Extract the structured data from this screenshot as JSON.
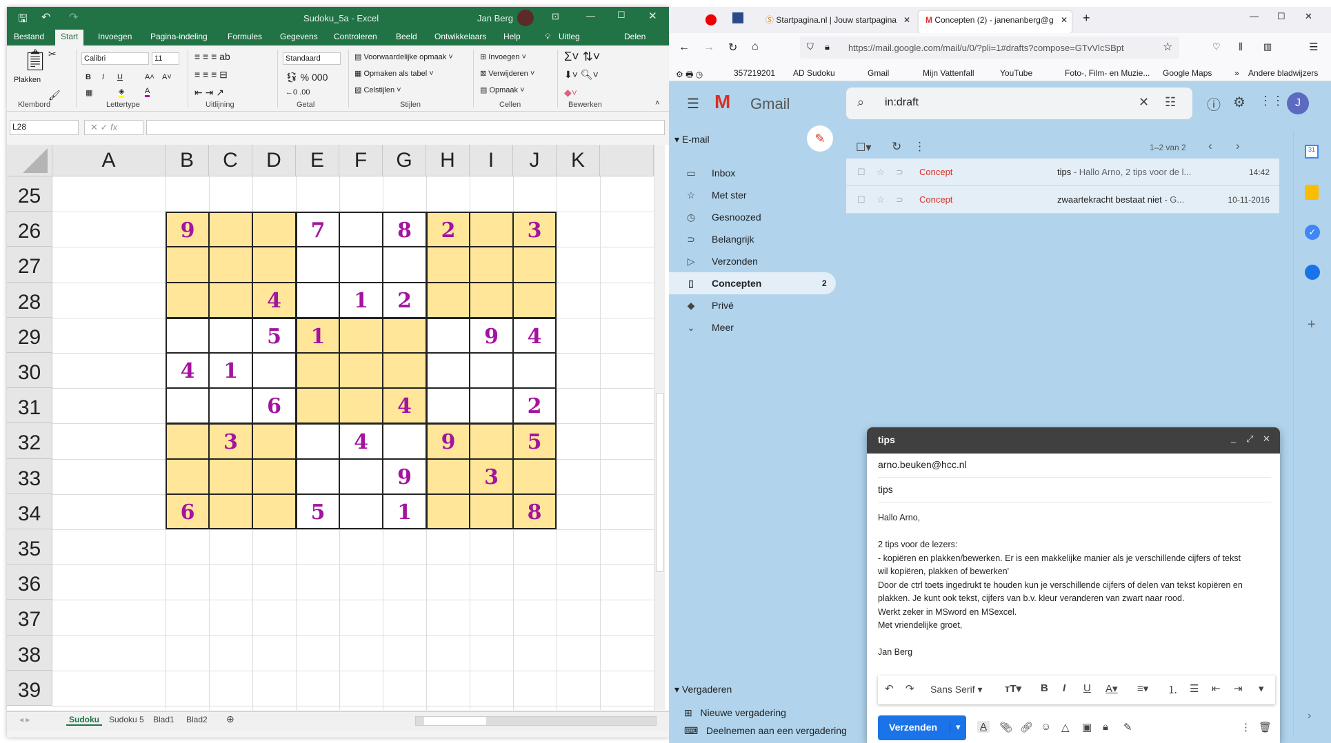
{
  "excel": {
    "title": "Sudoku_5a  -  Excel",
    "user": "Jan Berg",
    "tabs": [
      "Bestand",
      "Start",
      "Invoegen",
      "Pagina-indeling",
      "Formules",
      "Gegevens",
      "Controleren",
      "Beeld",
      "Ontwikkelaars",
      "Help",
      "Uitleg",
      "Delen"
    ],
    "ribbon": {
      "paste": "Plakken",
      "font": "Calibri",
      "size": "11",
      "number_format": "Standaard",
      "cond_format": "Voorwaardelijke opmaak",
      "format_table": "Opmaken als tabel",
      "cell_styles": "Celstijlen",
      "insert": "Invoegen",
      "delete": "Verwijderen",
      "format": "Opmaak",
      "groups": [
        "Klembord",
        "Lettertype",
        "Uitlijning",
        "Getal",
        "Stijlen",
        "Cellen",
        "Bewerken"
      ]
    },
    "name_box": "L28",
    "formula": "",
    "columns": [
      "A",
      "B",
      "C",
      "D",
      "E",
      "F",
      "G",
      "H",
      "I",
      "J",
      "K"
    ],
    "rows": [
      "25",
      "26",
      "27",
      "28",
      "29",
      "30",
      "31",
      "32",
      "33",
      "34",
      "35",
      "36",
      "37",
      "38",
      "39"
    ],
    "sudoku": [
      [
        "9",
        "",
        "",
        "7",
        "",
        "8",
        "2",
        "",
        "3"
      ],
      [
        "",
        "",
        "",
        "",
        "",
        "",
        "",
        "",
        ""
      ],
      [
        "",
        "",
        "4",
        "",
        "1",
        "2",
        "",
        "",
        ""
      ],
      [
        "",
        "",
        "5",
        "1",
        "",
        "",
        "",
        "9",
        "4"
      ],
      [
        "4",
        "1",
        "",
        "",
        "",
        "",
        "",
        "",
        ""
      ],
      [
        "",
        "",
        "6",
        "",
        "",
        "4",
        "",
        "",
        "2"
      ],
      [
        "",
        "3",
        "",
        "",
        "4",
        "",
        "9",
        "",
        "5"
      ],
      [
        "",
        "",
        "",
        "",
        "",
        "9",
        "",
        "3",
        ""
      ],
      [
        "6",
        "",
        "",
        "5",
        "",
        "1",
        "",
        "",
        "8"
      ]
    ],
    "colors": {
      "shade": "#ffe699",
      "digit": "#a3149f",
      "brand": "#217346"
    },
    "sheet_tabs": [
      "Sudoku",
      "Sudoku 5",
      "Blad1",
      "Blad2"
    ],
    "active_sheet": "Sudoku"
  },
  "browser": {
    "tabs": [
      {
        "title": "Startpagina.nl | Jouw startpagina"
      },
      {
        "title": "Concepten (2) - janenanberg@g"
      }
    ],
    "url": "https://mail.google.com/mail/u/0/?pli=1#drafts?compose=GTvVlcSBpt",
    "bookmarks": [
      "357219201",
      "AD Sudoku",
      "Gmail",
      "Mijn Vattenfall",
      "YouTube",
      "Foto-, Film- en Muzie...",
      "Google Maps",
      "Andere bladwijzers"
    ]
  },
  "gmail": {
    "logo": "Gmail",
    "search": "in:draft",
    "avatar": "J",
    "section_mail": "E-mail",
    "nav": [
      {
        "label": "Inbox",
        "icon": "inbox-icon",
        "glyph": "▭"
      },
      {
        "label": "Met ster",
        "icon": "star-icon",
        "glyph": "☆"
      },
      {
        "label": "Gesnoozed",
        "icon": "clock-icon",
        "glyph": "◷"
      },
      {
        "label": "Belangrijk",
        "icon": "important-icon",
        "glyph": "⊃"
      },
      {
        "label": "Verzonden",
        "icon": "send-icon",
        "glyph": "▷"
      },
      {
        "label": "Concepten",
        "icon": "draft-icon",
        "glyph": "▯",
        "count": "2"
      },
      {
        "label": "Privé",
        "icon": "label-icon",
        "glyph": "◆"
      },
      {
        "label": "Meer",
        "icon": "chevron-down-icon",
        "glyph": "⌄"
      }
    ],
    "pager": "1–2 van 2",
    "emails": [
      {
        "label": "Concept",
        "subject": "tips",
        "snippet": " - Hallo Arno, 2 tips voor de l...",
        "time": "14:42"
      },
      {
        "label": "Concept",
        "subject": "zwaartekracht bestaat niet",
        "snippet": " - G...",
        "time": "10-11-2016"
      }
    ],
    "section_meet": "Vergaderen",
    "meet": [
      "Nieuwe vergadering",
      "Deelnemen aan een vergadering"
    ],
    "compose": {
      "title": "tips",
      "to": "arno.beuken@hcc.nl",
      "subject": "tips",
      "body": [
        "Hallo Arno,",
        "",
        "2 tips voor de lezers:",
        "- kopiëren en plakken/bewerken. Er is een makkelijke manier als je verschillende cijfers of tekst",
        "wil kopiëren, plakken of bewerken'",
        "Door de ctrl toets ingedrukt te houden kun je verschillende cijfers of delen van tekst kopiëren en",
        "plakken. Je kunt ook tekst, cijfers van b.v. kleur veranderen van zwart naar rood.",
        "Werkt zeker in MSword en MSexcel.",
        "Met vriendelijke groet,",
        "",
        "Jan Berg"
      ],
      "font": "Sans Serif",
      "send": "Verzenden"
    },
    "colors": {
      "bg": "#b1d4ec",
      "concept": "#d93025",
      "send": "#1a73e8"
    }
  }
}
